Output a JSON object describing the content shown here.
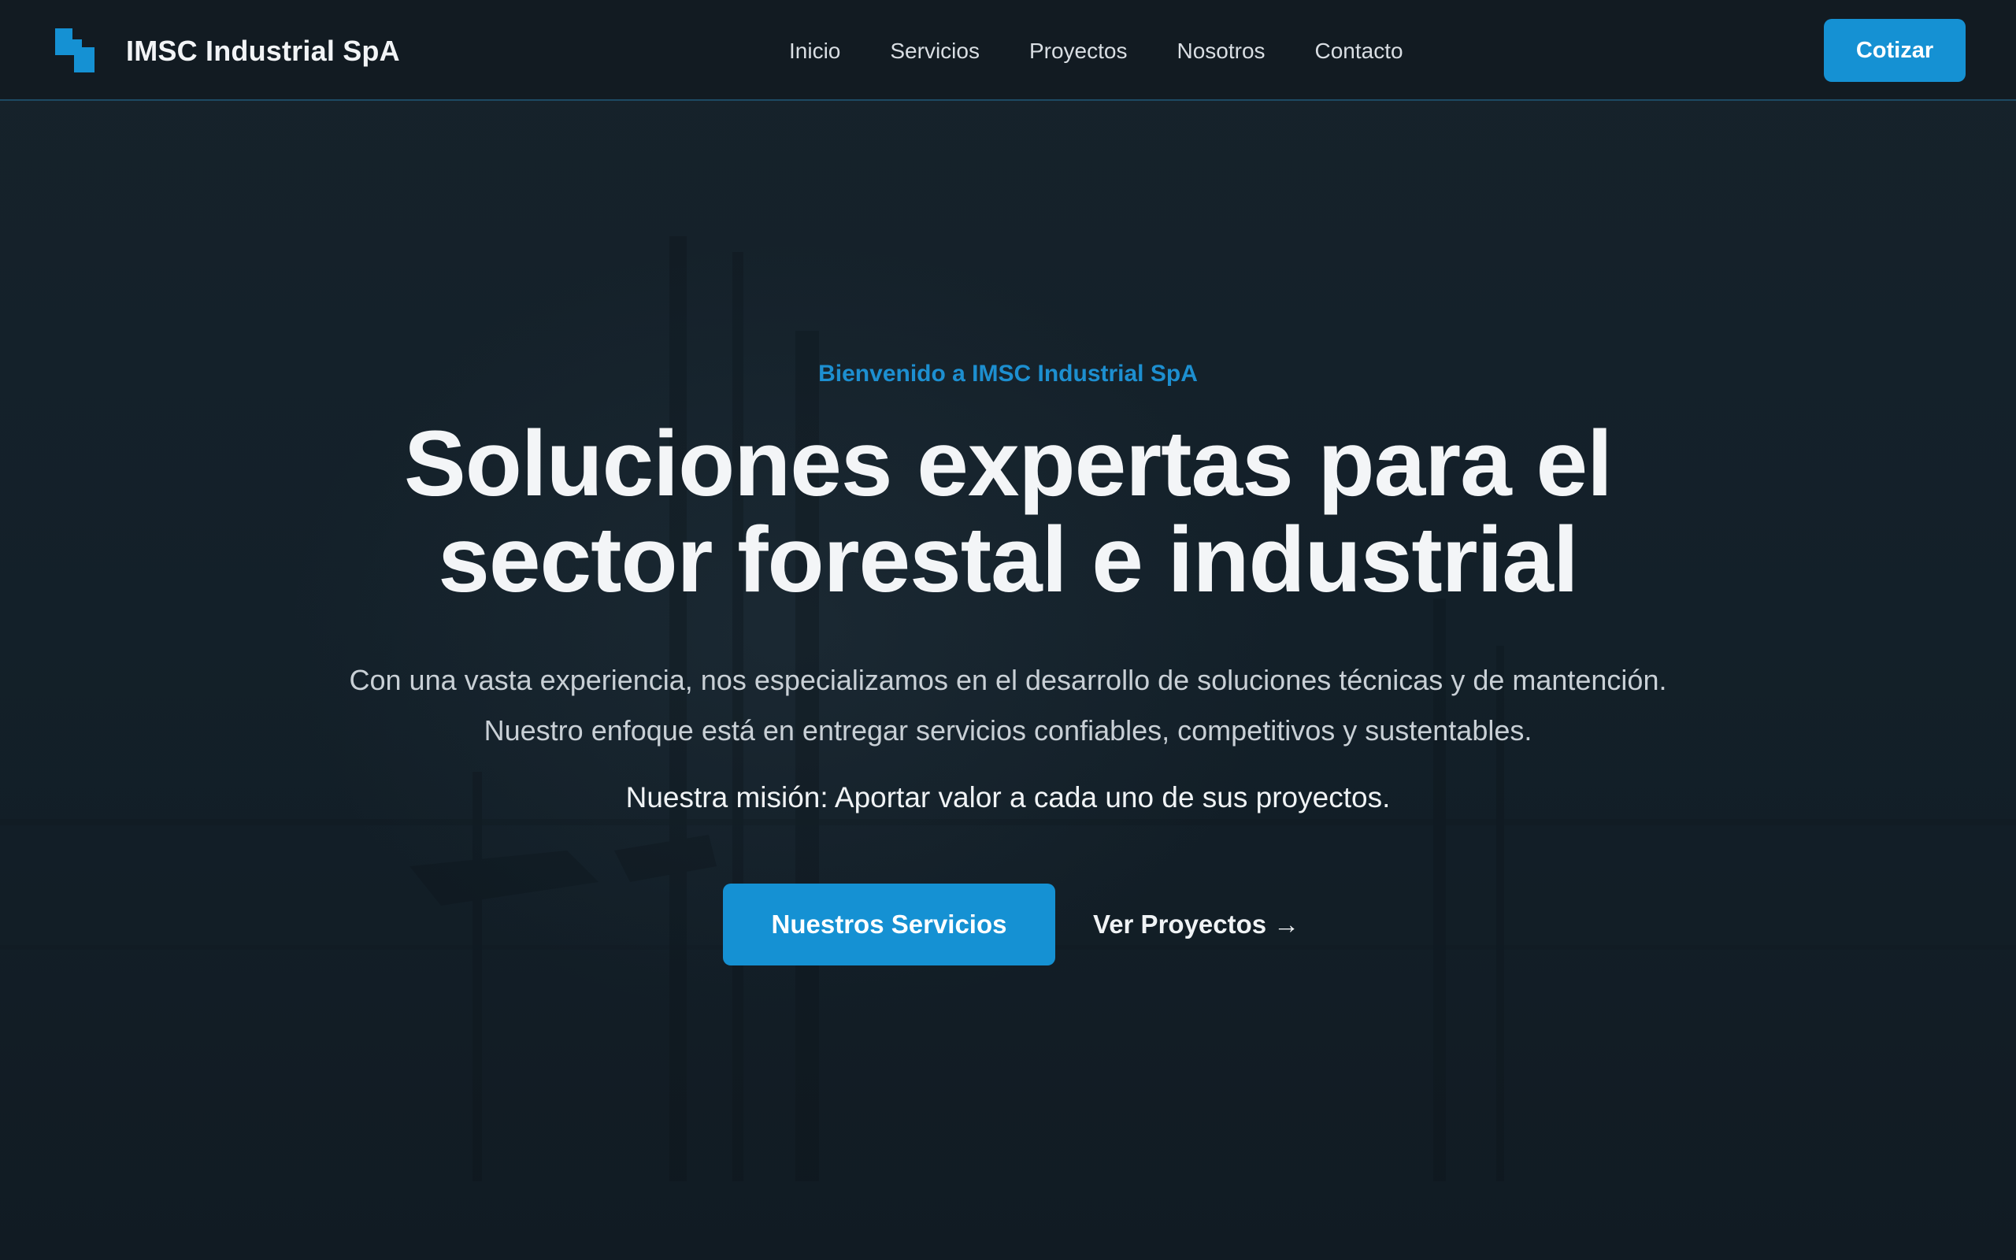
{
  "header": {
    "brand": "IMSC Industrial SpA",
    "logo_icon": "stacked-blocks-logo",
    "nav": [
      {
        "label": "Inicio"
      },
      {
        "label": "Servicios"
      },
      {
        "label": "Proyectos"
      },
      {
        "label": "Nosotros"
      },
      {
        "label": "Contacto"
      }
    ],
    "cta_label": "Cotizar"
  },
  "hero": {
    "eyebrow": "Bienvenido a IMSC Industrial SpA",
    "headline_line1": "Soluciones expertas para el",
    "headline_line2": "sector forestal e industrial",
    "subtitle_line1": "Con una vasta experiencia, nos especializamos en el desarrollo de soluciones técnicas y de mantención.",
    "subtitle_line2": "Nuestro enfoque está en entregar servicios confiables, competitivos y sustentables.",
    "mission": "Nuestra misión: Aportar valor a cada uno de sus proyectos.",
    "primary_button": "Nuestros Servicios",
    "secondary_link": "Ver Proyectos →"
  },
  "colors": {
    "accent": "#1591d3",
    "background": "#131d25",
    "header_bg": "#121b22",
    "text_primary": "#f3f5f7",
    "text_secondary": "#c9d0d6"
  }
}
